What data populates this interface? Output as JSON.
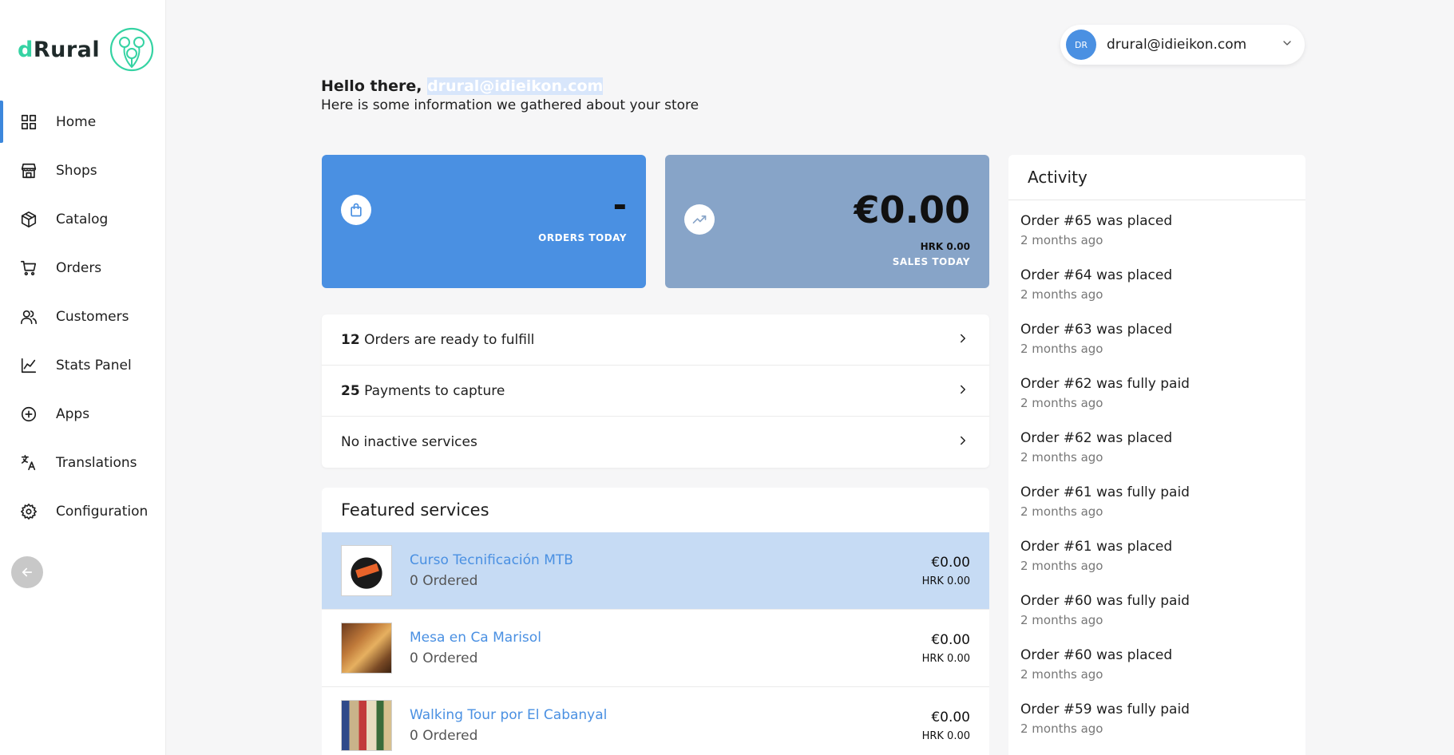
{
  "brand": {
    "name_prefix": "d",
    "name_rest": "Rural",
    "accent": "#35d3a3"
  },
  "sidebar": {
    "items": [
      {
        "label": "Home",
        "icon": "grid-icon"
      },
      {
        "label": "Shops",
        "icon": "storefront-icon"
      },
      {
        "label": "Catalog",
        "icon": "box-icon"
      },
      {
        "label": "Orders",
        "icon": "cart-icon"
      },
      {
        "label": "Customers",
        "icon": "users-icon"
      },
      {
        "label": "Stats Panel",
        "icon": "chart-icon"
      },
      {
        "label": "Apps",
        "icon": "plus-circle-icon"
      },
      {
        "label": "Translations",
        "icon": "translate-icon"
      },
      {
        "label": "Configuration",
        "icon": "gear-icon"
      }
    ],
    "active": "Home"
  },
  "user": {
    "initials": "DR",
    "email": "drural@idieikon.com"
  },
  "greeting": {
    "hello": "Hello there,",
    "email": "drural@idieikon.com",
    "subtitle": "Here is some information we gathered about your store"
  },
  "stats": {
    "orders": {
      "value": "-",
      "label": "ORDERS TODAY",
      "color": "#4a90e2"
    },
    "sales": {
      "value": "€0.00",
      "secondary": "HRK 0.00",
      "label": "SALES TODAY",
      "color": "#87a4c8"
    }
  },
  "tasks": [
    {
      "count": "12",
      "text": "Orders are ready to fulfill"
    },
    {
      "count": "25",
      "text": "Payments to capture"
    },
    {
      "count": "",
      "text": "No inactive services"
    }
  ],
  "featured": {
    "title": "Featured services",
    "items": [
      {
        "name": "Curso Tecnificación MTB",
        "ordered": "0 Ordered",
        "price_eur": "€0.00",
        "price_hrk": "HRK 0.00"
      },
      {
        "name": "Mesa en Ca Marisol",
        "ordered": "0 Ordered",
        "price_eur": "€0.00",
        "price_hrk": "HRK 0.00"
      },
      {
        "name": "Walking Tour por El Cabanyal",
        "ordered": "0 Ordered",
        "price_eur": "€0.00",
        "price_hrk": "HRK 0.00"
      }
    ]
  },
  "activity": {
    "title": "Activity",
    "items": [
      {
        "text": "Order #65 was placed",
        "time": "2 months ago"
      },
      {
        "text": "Order #64 was placed",
        "time": "2 months ago"
      },
      {
        "text": "Order #63 was placed",
        "time": "2 months ago"
      },
      {
        "text": "Order #62 was fully paid",
        "time": "2 months ago"
      },
      {
        "text": "Order #62 was placed",
        "time": "2 months ago"
      },
      {
        "text": "Order #61 was fully paid",
        "time": "2 months ago"
      },
      {
        "text": "Order #61 was placed",
        "time": "2 months ago"
      },
      {
        "text": "Order #60 was fully paid",
        "time": "2 months ago"
      },
      {
        "text": "Order #60 was placed",
        "time": "2 months ago"
      },
      {
        "text": "Order #59 was fully paid",
        "time": "2 months ago"
      }
    ]
  }
}
